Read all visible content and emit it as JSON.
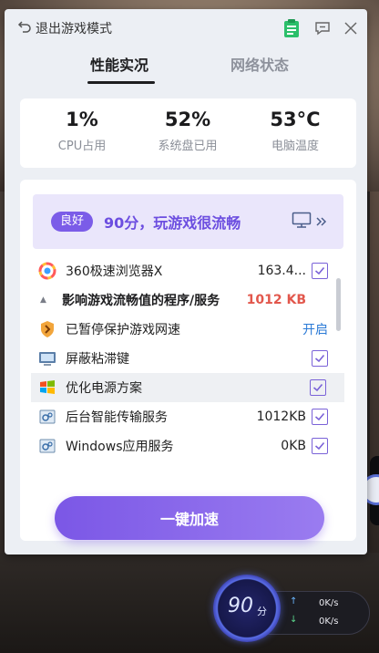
{
  "titlebar": {
    "exit_label": "退出游戏模式"
  },
  "tabs": [
    {
      "label": "性能实况",
      "active": true
    },
    {
      "label": "网络状态",
      "active": false
    }
  ],
  "stats": {
    "cpu": {
      "value": "1%",
      "label": "CPU占用"
    },
    "disk": {
      "value": "52%",
      "label": "系统盘已用"
    },
    "temp": {
      "value": "53°C",
      "label": "电脑温度"
    }
  },
  "banner": {
    "badge": "良好",
    "text": "90分，玩游戏很流畅"
  },
  "list": {
    "rows": [
      {
        "name": "360极速浏览器X",
        "size": "163.4...",
        "checked": true,
        "icon": "browser-icon"
      },
      {
        "name": "影响游戏流畅值的程序/服务",
        "size": "1012 KB",
        "section": true
      },
      {
        "name": "已暂停保护游戏网速",
        "action": "开启",
        "icon": "shield-speed-icon"
      },
      {
        "name": "屏蔽粘滞键",
        "checked": true,
        "icon": "keyboard-icon"
      },
      {
        "name": "优化电源方案",
        "checked": true,
        "icon": "power-plan-icon"
      },
      {
        "name": "后台智能传输服务",
        "size": "1012KB",
        "checked": true,
        "icon": "service-icon"
      },
      {
        "name": "Windows应用服务",
        "size": "0KB",
        "checked": true,
        "icon": "service-icon"
      }
    ]
  },
  "boost_button": "一键加速",
  "widget": {
    "score": "90",
    "unit": "分",
    "upload": "0K/s",
    "download": "0K/s"
  },
  "colors": {
    "accent": "#7b5ce8",
    "warning": "#e2574c",
    "link": "#2b7ad6"
  }
}
